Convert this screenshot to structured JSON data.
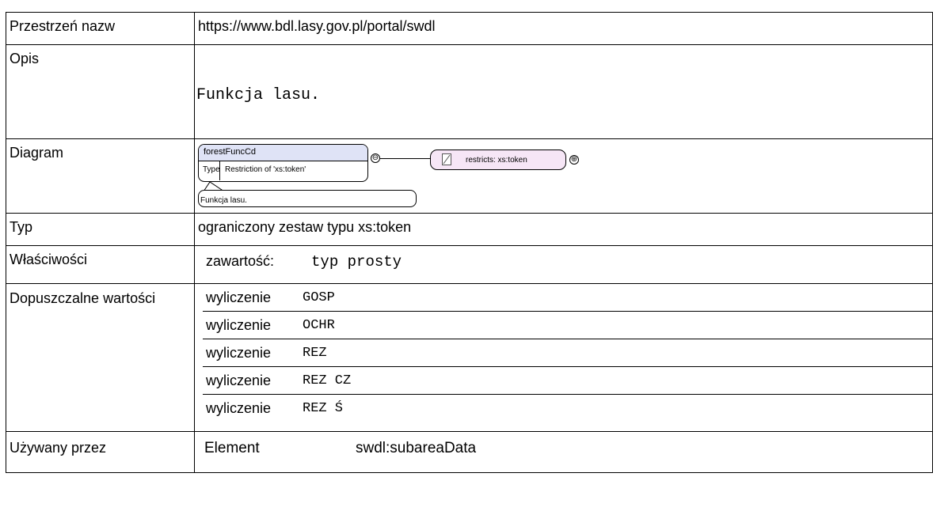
{
  "rows": {
    "namespace": {
      "label": "Przestrzeń nazw",
      "value": "https://www.bdl.lasy.gov.pl/portal/swdl"
    },
    "description": {
      "label": "Opis",
      "value": "Funkcja lasu."
    },
    "diagram": {
      "label": "Diagram",
      "element_name": "forestFuncCd",
      "type_key": "Type",
      "type_value": "Restriction of 'xs:token'",
      "restricts": "restricts: xs:token",
      "collapse_symbol": "⊖",
      "expand_symbol": "⊕",
      "doc_text": "Funkcja lasu."
    },
    "type": {
      "label": "Typ",
      "value": "ograniczony zestaw typu xs:token"
    },
    "properties": {
      "label": "Właściwości",
      "key": "zawartość:",
      "value": "typ prosty"
    },
    "allowed_values": {
      "label": "Dopuszczalne wartości",
      "items": [
        {
          "key": "wyliczenie",
          "value": "GOSP"
        },
        {
          "key": "wyliczenie",
          "value": "OCHR"
        },
        {
          "key": "wyliczenie",
          "value": "REZ"
        },
        {
          "key": "wyliczenie",
          "value": "REZ CZ"
        },
        {
          "key": "wyliczenie",
          "value": "REZ Ś"
        }
      ]
    },
    "used_by": {
      "label": "Używany przez",
      "key": "Element",
      "value": "swdl:subareaData"
    }
  },
  "colors": {
    "element_header": "#dfe3f6",
    "restriction_box": "#f6e6f6"
  }
}
